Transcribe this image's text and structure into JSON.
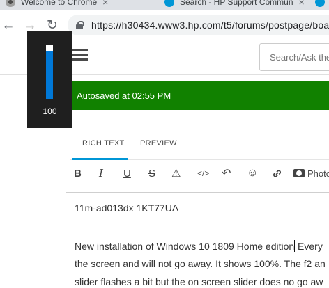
{
  "browser": {
    "tabs": [
      {
        "title": "Welcome to Chrome",
        "icon": "chrome-icon"
      },
      {
        "title": "Search - HP Support Commun",
        "icon": "hp-logo-icon"
      },
      {
        "title": "",
        "icon": "hp-logo-icon"
      }
    ],
    "url": "https://h30434.www3.hp.com/t5/forums/postpage/boa"
  },
  "header": {
    "search_placeholder": "Search/Ask the"
  },
  "brightness_osd": {
    "value_label": "100",
    "level_percent": 100
  },
  "banner": {
    "text": "Autosaved at 02:55 PM"
  },
  "editor_tabs": [
    {
      "label": "RICH TEXT",
      "active": true
    },
    {
      "label": "PREVIEW",
      "active": false
    }
  ],
  "format_toolbar": {
    "bold": "B",
    "italic": "I",
    "underline": "U",
    "strike": "S",
    "warning": "⚠",
    "code": "</>",
    "undo": "↶",
    "emoji": "☺",
    "link": "🔗",
    "photo_label": "Photo"
  },
  "editor": {
    "model_line": "11m-ad013dx 1KT77UA",
    "body_line1_a": "New installation of Windows 10 1809 Home edition",
    "body_line1_b": " Every",
    "body_line2": "the screen and will not go away. It shows 100%. The f2 an",
    "body_line3": "slider flashes a bit but the on screen slider does no go aw"
  },
  "colors": {
    "banner": "#118100",
    "accent": "#0096d6",
    "osd_bg": "#1f1f1f",
    "osd_fill": "#0078d7"
  }
}
